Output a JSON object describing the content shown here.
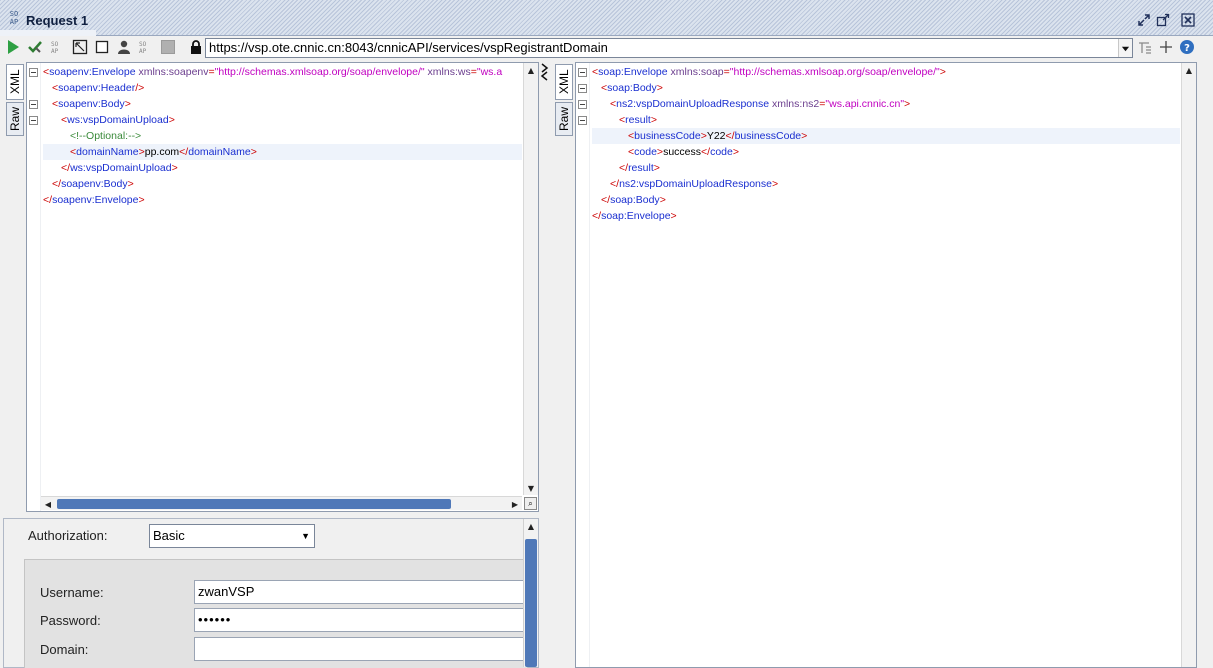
{
  "window": {
    "badge": "SOAP",
    "title": "Request 1"
  },
  "toolbar": {
    "url": "https://vsp.ote.cnnic.cn:8043/cnnicAPI/services/vspRegistrantDomain"
  },
  "request_tabs": {
    "xml": "XML",
    "raw": "Raw"
  },
  "response_tabs": {
    "xml": "XML",
    "raw": "Raw"
  },
  "request_xml": [
    {
      "indent": 0,
      "fold": true,
      "parts": [
        [
          "tag",
          "<"
        ],
        [
          "tname",
          "soapenv:Envelope"
        ],
        [
          "attr",
          " xmlns:soapenv"
        ],
        [
          "tag",
          "="
        ],
        [
          "aval",
          "\"http://schemas.xmlsoap.org/soap/envelope/\""
        ],
        [
          "attr",
          " xmlns:ws"
        ],
        [
          "tag",
          "="
        ],
        [
          "aval",
          "\"ws.a"
        ]
      ]
    },
    {
      "indent": 1,
      "fold": false,
      "parts": [
        [
          "tag",
          "<"
        ],
        [
          "tname",
          "soapenv:Header"
        ],
        [
          "tag",
          "/>"
        ]
      ]
    },
    {
      "indent": 1,
      "fold": true,
      "parts": [
        [
          "tag",
          "<"
        ],
        [
          "tname",
          "soapenv:Body"
        ],
        [
          "tag",
          ">"
        ]
      ]
    },
    {
      "indent": 2,
      "fold": true,
      "parts": [
        [
          "tag",
          "<"
        ],
        [
          "tname",
          "ws:vspDomainUpload"
        ],
        [
          "tag",
          ">"
        ]
      ]
    },
    {
      "indent": 3,
      "fold": false,
      "parts": [
        [
          "cmt",
          "<!--Optional:-->"
        ]
      ]
    },
    {
      "indent": 3,
      "fold": false,
      "hl": true,
      "parts": [
        [
          "tag",
          "<"
        ],
        [
          "tname",
          "domainName"
        ],
        [
          "tag",
          ">"
        ],
        [
          "txt",
          "pp.com"
        ],
        [
          "tag",
          "</"
        ],
        [
          "tname",
          "domainName"
        ],
        [
          "tag",
          ">"
        ]
      ]
    },
    {
      "indent": 2,
      "fold": false,
      "parts": [
        [
          "tag",
          "</"
        ],
        [
          "tname",
          "ws:vspDomainUpload"
        ],
        [
          "tag",
          ">"
        ]
      ]
    },
    {
      "indent": 1,
      "fold": false,
      "parts": [
        [
          "tag",
          "</"
        ],
        [
          "tname",
          "soapenv:Body"
        ],
        [
          "tag",
          ">"
        ]
      ]
    },
    {
      "indent": 0,
      "fold": false,
      "parts": [
        [
          "tag",
          "</"
        ],
        [
          "tname",
          "soapenv:Envelope"
        ],
        [
          "tag",
          ">"
        ]
      ]
    }
  ],
  "response_xml": [
    {
      "indent": 0,
      "fold": true,
      "parts": [
        [
          "tag",
          "<"
        ],
        [
          "tname",
          "soap:Envelope"
        ],
        [
          "attr",
          " xmlns:soap"
        ],
        [
          "tag",
          "="
        ],
        [
          "aval",
          "\"http://schemas.xmlsoap.org/soap/envelope/\""
        ],
        [
          "tag",
          ">"
        ]
      ]
    },
    {
      "indent": 1,
      "fold": true,
      "parts": [
        [
          "tag",
          "<"
        ],
        [
          "tname",
          "soap:Body"
        ],
        [
          "tag",
          ">"
        ]
      ]
    },
    {
      "indent": 2,
      "fold": true,
      "parts": [
        [
          "tag",
          "<"
        ],
        [
          "tname",
          "ns2:vspDomainUploadResponse"
        ],
        [
          "attr",
          " xmlns:ns2"
        ],
        [
          "tag",
          "="
        ],
        [
          "aval",
          "\"ws.api.cnnic.cn\""
        ],
        [
          "tag",
          ">"
        ]
      ]
    },
    {
      "indent": 3,
      "fold": true,
      "parts": [
        [
          "tag",
          "<"
        ],
        [
          "tname",
          "result"
        ],
        [
          "tag",
          ">"
        ]
      ]
    },
    {
      "indent": 4,
      "fold": false,
      "hl": true,
      "parts": [
        [
          "tag",
          "<"
        ],
        [
          "tname",
          "businessCode"
        ],
        [
          "tag",
          ">"
        ],
        [
          "txt",
          "Y22"
        ],
        [
          "tag",
          "</"
        ],
        [
          "tname",
          "businessCode"
        ],
        [
          "tag",
          ">"
        ]
      ]
    },
    {
      "indent": 4,
      "fold": false,
      "parts": [
        [
          "tag",
          "<"
        ],
        [
          "tname",
          "code"
        ],
        [
          "tag",
          ">"
        ],
        [
          "txt",
          "success"
        ],
        [
          "tag",
          "</"
        ],
        [
          "tname",
          "code"
        ],
        [
          "tag",
          ">"
        ]
      ]
    },
    {
      "indent": 3,
      "fold": false,
      "parts": [
        [
          "tag",
          "</"
        ],
        [
          "tname",
          "result"
        ],
        [
          "tag",
          ">"
        ]
      ]
    },
    {
      "indent": 2,
      "fold": false,
      "parts": [
        [
          "tag",
          "</"
        ],
        [
          "tname",
          "ns2:vspDomainUploadResponse"
        ],
        [
          "tag",
          ">"
        ]
      ]
    },
    {
      "indent": 1,
      "fold": false,
      "parts": [
        [
          "tag",
          "</"
        ],
        [
          "tname",
          "soap:Body"
        ],
        [
          "tag",
          ">"
        ]
      ]
    },
    {
      "indent": 0,
      "fold": false,
      "parts": [
        [
          "tag",
          "</"
        ],
        [
          "tname",
          "soap:Envelope"
        ],
        [
          "tag",
          ">"
        ]
      ]
    }
  ],
  "auth": {
    "authorization_label": "Authorization:",
    "authorization_value": "Basic",
    "username_label": "Username:",
    "username_value": "zwanVSP",
    "password_label": "Password:",
    "password_value": "••••••",
    "domain_label": "Domain:",
    "domain_value": ""
  },
  "colors": {
    "tag": "#cc0000",
    "tag_name": "#1a2fd0",
    "attribute": "#6b3e8e",
    "attribute_value": "#c000c0",
    "comment": "#3a8a3a",
    "scrollbar_thumb": "#4f78b8"
  },
  "icons": [
    "soap-icon",
    "restore-icon",
    "maximize-icon",
    "close-icon",
    "run-icon",
    "validate-icon",
    "endpoint-icon",
    "format-icon",
    "stop-icon",
    "user-icon",
    "wss-icon",
    "gray-box-icon",
    "lock-icon",
    "attach-icon",
    "add-icon",
    "help-icon"
  ]
}
